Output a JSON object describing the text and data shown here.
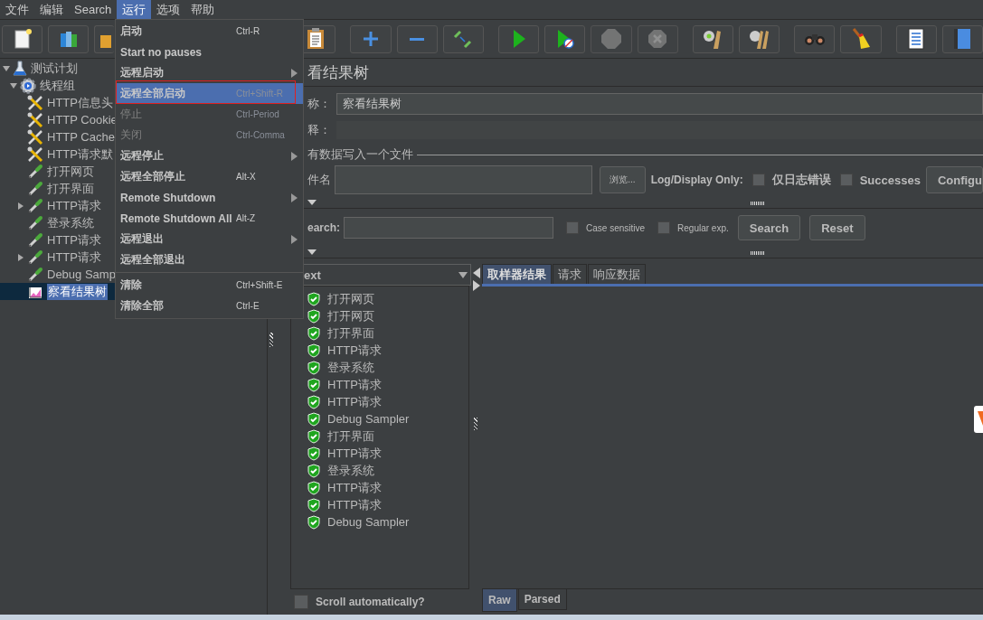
{
  "menu_bar": [
    {
      "label": "文件",
      "selected": false
    },
    {
      "label": "编辑",
      "selected": false
    },
    {
      "label": "Search",
      "selected": false
    },
    {
      "label": "运行",
      "selected": true
    },
    {
      "label": "选项",
      "selected": false
    },
    {
      "label": "帮助",
      "selected": false
    }
  ],
  "toolbar": [
    {
      "kind": "new",
      "disabled": false
    },
    {
      "kind": "templates",
      "disabled": false
    },
    {
      "kind": "open",
      "disabled": false
    },
    {
      "kind": "paste",
      "disabled": false
    },
    {
      "kind": "expand",
      "disabled": false
    },
    {
      "kind": "collapse",
      "disabled": false
    },
    {
      "kind": "toggle",
      "disabled": false
    },
    {
      "kind": "start",
      "disabled": false
    },
    {
      "kind": "start_no_pause",
      "disabled": false
    },
    {
      "kind": "stop",
      "disabled": true
    },
    {
      "kind": "shutdown",
      "disabled": true
    },
    {
      "kind": "clear",
      "disabled": false
    },
    {
      "kind": "clear_all",
      "disabled": false
    },
    {
      "kind": "search",
      "disabled": false
    },
    {
      "kind": "reset_search",
      "disabled": false
    },
    {
      "kind": "function_helper",
      "disabled": false
    },
    {
      "kind": "help",
      "disabled": false
    }
  ],
  "tree": [
    {
      "label": "测试计划",
      "kind": "plan",
      "expanded": true,
      "selected": false,
      "children": [
        {
          "label": "线程组",
          "kind": "threads",
          "expanded": true,
          "selected": false,
          "children": [
            {
              "label": "HTTP信息头",
              "kind": "config",
              "selected": false
            },
            {
              "label": "HTTP Cookie",
              "kind": "config",
              "selected": false
            },
            {
              "label": "HTTP Cache",
              "kind": "config",
              "selected": false
            },
            {
              "label": "HTTP请求默",
              "kind": "config",
              "selected": false
            },
            {
              "label": "打开网页",
              "kind": "sampler",
              "selected": false
            },
            {
              "label": "打开界面",
              "kind": "sampler",
              "selected": false
            },
            {
              "label": "HTTP请求",
              "kind": "sampler",
              "expanded": false,
              "selected": false
            },
            {
              "label": "登录系统",
              "kind": "sampler",
              "selected": false
            },
            {
              "label": "HTTP请求",
              "kind": "sampler",
              "selected": false
            },
            {
              "label": "HTTP请求",
              "kind": "sampler",
              "expanded": false,
              "selected": false
            },
            {
              "label": "Debug Samp",
              "kind": "sampler",
              "selected": false
            },
            {
              "label": "察看结果树",
              "kind": "listener",
              "selected": true
            }
          ]
        }
      ]
    }
  ],
  "run_menu": [
    {
      "label": "启动",
      "shortcut": "Ctrl-R",
      "submenu": false,
      "disabled": false,
      "selected": false,
      "outlined": false
    },
    {
      "label": "Start no pauses",
      "submenu": false,
      "disabled": false,
      "selected": false,
      "outlined": false
    },
    {
      "label": "远程启动",
      "submenu": true,
      "disabled": false,
      "selected": false,
      "outlined": false
    },
    {
      "label": "远程全部启动",
      "shortcut": "Ctrl+Shift-R",
      "submenu": false,
      "disabled": false,
      "selected": true,
      "outlined": true
    },
    {
      "label": "停止",
      "shortcut": "Ctrl-Period",
      "submenu": false,
      "disabled": true,
      "selected": false,
      "outlined": false
    },
    {
      "label": "关闭",
      "shortcut": "Ctrl-Comma",
      "submenu": false,
      "disabled": true,
      "selected": false,
      "outlined": false
    },
    {
      "label": "远程停止",
      "submenu": true,
      "disabled": false,
      "selected": false,
      "outlined": false
    },
    {
      "label": "远程全部停止",
      "shortcut": "Alt-X",
      "submenu": false,
      "disabled": false,
      "selected": false,
      "outlined": false
    },
    {
      "label": "Remote Shutdown",
      "submenu": true,
      "disabled": false,
      "selected": false,
      "outlined": false
    },
    {
      "label": "Remote Shutdown All",
      "shortcut": "Alt-Z",
      "submenu": false,
      "disabled": false,
      "selected": false,
      "outlined": false
    },
    {
      "label": "远程退出",
      "submenu": true,
      "disabled": false,
      "selected": false,
      "outlined": false
    },
    {
      "label": "远程全部退出",
      "submenu": false,
      "disabled": false,
      "selected": false,
      "outlined": false,
      "separator_after": true
    },
    {
      "label": "清除",
      "shortcut": "Ctrl+Shift-E",
      "submenu": false,
      "disabled": false,
      "selected": false,
      "outlined": false
    },
    {
      "label": "清除全部",
      "shortcut": "Ctrl-E",
      "submenu": false,
      "disabled": false,
      "selected": false,
      "outlined": false
    }
  ],
  "listener": {
    "title": "看结果树",
    "name_label": "称：",
    "name_value": "察看结果树",
    "comment_label": "释：",
    "file_section": "有数据写入一个文件",
    "filename_label": "件名",
    "browse_button": "浏览...",
    "log_display_label": "Log/Display Only:",
    "log_options": [
      {
        "label": "仅日志错误",
        "checked": false
      },
      {
        "label": "Successes",
        "checked": false
      }
    ],
    "configure_button": "Configu",
    "search_label": "earch:",
    "search_options": [
      {
        "label": "Case sensitive",
        "checked": false
      },
      {
        "label": "Regular exp.",
        "checked": false
      }
    ],
    "search_button": "Search",
    "reset_button": "Reset",
    "renderer": "ext",
    "results": [
      {
        "label": "打开网页",
        "ok": true
      },
      {
        "label": "打开网页",
        "ok": true
      },
      {
        "label": "打开界面",
        "ok": true
      },
      {
        "label": "HTTP请求",
        "ok": true
      },
      {
        "label": "登录系统",
        "ok": true
      },
      {
        "label": "HTTP请求",
        "ok": true
      },
      {
        "label": "HTTP请求",
        "ok": true
      },
      {
        "label": "Debug Sampler",
        "ok": true
      },
      {
        "label": "打开界面",
        "ok": true
      },
      {
        "label": "HTTP请求",
        "ok": true
      },
      {
        "label": "登录系统",
        "ok": true
      },
      {
        "label": "HTTP请求",
        "ok": true
      },
      {
        "label": "HTTP请求",
        "ok": true
      },
      {
        "label": "Debug Sampler",
        "ok": true
      }
    ],
    "scroll_auto": {
      "label": "Scroll automatically?",
      "checked": false
    },
    "tabs": [
      {
        "label": "取样器结果",
        "selected": true
      },
      {
        "label": "请求",
        "selected": false
      },
      {
        "label": "响应数据",
        "selected": false
      }
    ],
    "view_tabs": [
      {
        "label": "Raw",
        "selected": true
      },
      {
        "label": "Parsed",
        "selected": false
      }
    ]
  }
}
